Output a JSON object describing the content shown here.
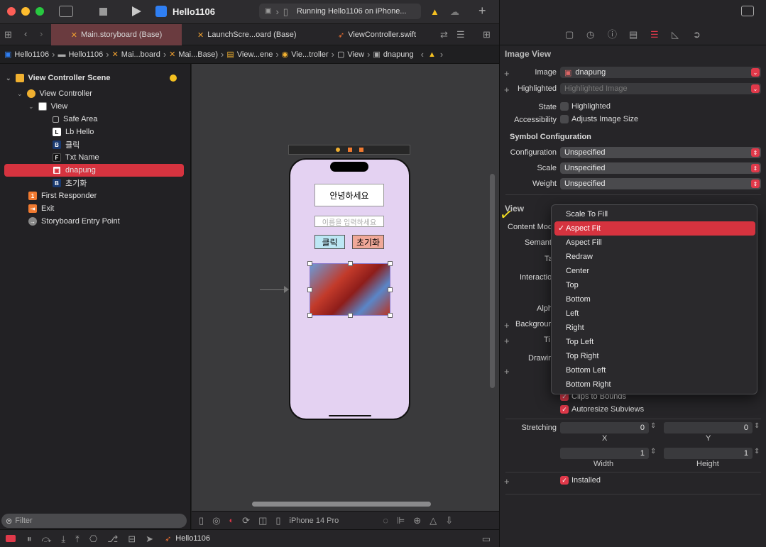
{
  "project": "Hello1106",
  "status": "Running Hello1106 on iPhone...",
  "tabs": [
    "Main.storyboard (Base)",
    "LaunchScre...oard (Base)",
    "ViewController.swift"
  ],
  "jump": [
    "Hello1106",
    "Hello1106",
    "Mai...board",
    "Mai...Base)",
    "View...ene",
    "Vie...troller",
    "View",
    "dnapung"
  ],
  "nav": {
    "scene": "View Controller Scene",
    "vc": "View Controller",
    "view": "View",
    "safe": "Safe Area",
    "lb": "Lb Hello",
    "click": "클릭",
    "txt": "Txt Name",
    "img": "dnapung",
    "reset": "초기화",
    "fr": "First Responder",
    "exit": "Exit",
    "entry": "Storyboard Entry Point",
    "filter": "Filter"
  },
  "device": {
    "greeting": "안녕하세요",
    "placeholder": "이름을 입력하세요",
    "click": "클릭",
    "reset": "초기화"
  },
  "canvasbar": {
    "device": "iPhone 14 Pro"
  },
  "insp": {
    "section": "Image View",
    "image_label": "Image",
    "image_value": "dnapung",
    "highlighted_label": "Highlighted",
    "highlighted_placeholder": "Highlighted Image",
    "state_label": "State",
    "state_value": "Highlighted",
    "access_label": "Accessibility",
    "access_value": "Adjusts Image Size",
    "symbol": "Symbol Configuration",
    "config_label": "Configuration",
    "config_value": "Unspecified",
    "scale_label": "Scale",
    "scale_value": "Unspecified",
    "weight_label": "Weight",
    "weight_value": "Unspecified",
    "view_section": "View",
    "content_mode": "Content Mod",
    "semantic": "Semant",
    "tag": "Ta",
    "interaction": "Interaction",
    "alpha": "Alph",
    "background": "Backgrour",
    "tint": "Ti",
    "drawing": "Drawin",
    "clips": "Clips to Bounds",
    "autoresize": "Autoresize Subviews",
    "stretching": "Stretching",
    "x_val": "0",
    "y_val": "0",
    "x": "X",
    "y": "Y",
    "w_val": "1",
    "h_val": "1",
    "width": "Width",
    "height": "Height",
    "installed": "Installed"
  },
  "menu": [
    "Scale To Fill",
    "Aspect Fit",
    "Aspect Fill",
    "Redraw",
    "Center",
    "Top",
    "Bottom",
    "Left",
    "Right",
    "Top Left",
    "Top Right",
    "Bottom Left",
    "Bottom Right"
  ],
  "bottom_scheme": "Hello1106"
}
